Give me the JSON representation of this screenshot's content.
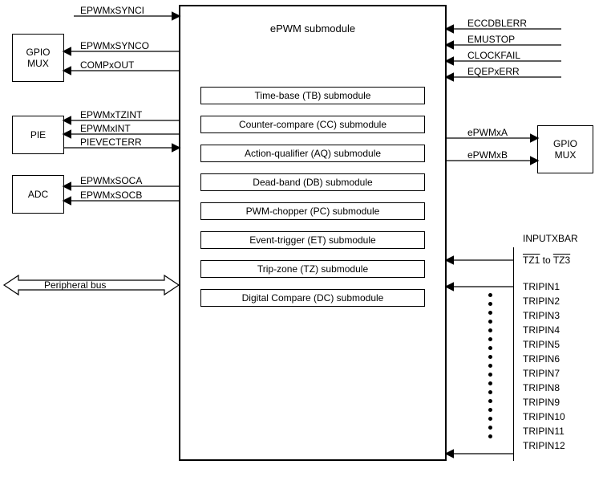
{
  "main_block": {
    "title": "ePWM submodule"
  },
  "left_boxes": {
    "gpio_mux": "GPIO\nMUX",
    "pie": "PIE",
    "adc": "ADC"
  },
  "right_boxes": {
    "gpio_mux": "GPIO\nMUX",
    "inputxbar_title": "INPUTXBAR"
  },
  "submodules": [
    "Time-base (TB) submodule",
    "Counter-compare (CC) submodule",
    "Action-qualifier (AQ) submodule",
    "Dead-band (DB) submodule",
    "PWM-chopper (PC) submodule",
    "Event-trigger (ET) submodule",
    "Trip-zone (TZ) submodule",
    "Digital Compare (DC) submodule"
  ],
  "left_signals": {
    "sync_in": "EPWMxSYNCI",
    "sync_out": "EPWMxSYNCO",
    "comp_out": "COMPxOUT",
    "tzint": "EPWMxTZINT",
    "xint": "EPWMxINT",
    "pievect": "PIEVECTERR",
    "soca": "EPWMxSOCA",
    "socb": "EPWMxSOCB",
    "pbus": "Peripheral bus"
  },
  "right_signals": {
    "eccdblerr": "ECCDBLERR",
    "emustop": "EMUSTOP",
    "clockfail": "CLOCKFAIL",
    "eqepxerr": "EQEPxERR",
    "epwma": "ePWMxA",
    "epwmb": "ePWMxB"
  },
  "inputxbar": {
    "tz": "TZ1 to TZ3",
    "tripins": [
      "TRIPIN1",
      "TRIPIN2",
      "TRIPIN3",
      "TRIPIN4",
      "TRIPIN5",
      "TRIPIN6",
      "TRIPIN7",
      "TRIPIN8",
      "TRIPIN9",
      "TRIPIN10",
      "TRIPIN11",
      "TRIPIN12"
    ]
  },
  "chart_data": {
    "type": "diagram",
    "title": "ePWM submodule block diagram",
    "nodes": [
      {
        "id": "epwm",
        "label": "ePWM submodule",
        "contains": [
          "Time-base (TB) submodule",
          "Counter-compare (CC) submodule",
          "Action-qualifier (AQ) submodule",
          "Dead-band (DB) submodule",
          "PWM-chopper (PC) submodule",
          "Event-trigger (ET) submodule",
          "Trip-zone (TZ) submodule",
          "Digital Compare (DC) submodule"
        ]
      },
      {
        "id": "gpio_mux_left",
        "label": "GPIO MUX"
      },
      {
        "id": "pie",
        "label": "PIE"
      },
      {
        "id": "adc",
        "label": "ADC"
      },
      {
        "id": "gpio_mux_right",
        "label": "GPIO MUX"
      },
      {
        "id": "inputxbar",
        "label": "INPUTXBAR",
        "contains": [
          "TZ1 to TZ3",
          "TRIPIN1",
          "TRIPIN2",
          "TRIPIN3",
          "TRIPIN4",
          "TRIPIN5",
          "TRIPIN6",
          "TRIPIN7",
          "TRIPIN8",
          "TRIPIN9",
          "TRIPIN10",
          "TRIPIN11",
          "TRIPIN12"
        ]
      },
      {
        "id": "pbus",
        "label": "Peripheral bus"
      }
    ],
    "edges": [
      {
        "from": "ext",
        "to": "epwm",
        "label": "EPWMxSYNCI",
        "dir": "in"
      },
      {
        "from": "epwm",
        "to": "gpio_mux_left",
        "label": "EPWMxSYNCO",
        "dir": "out"
      },
      {
        "from": "epwm",
        "to": "gpio_mux_left",
        "label": "COMPxOUT",
        "dir": "out"
      },
      {
        "from": "epwm",
        "to": "pie",
        "label": "EPWMxTZINT",
        "dir": "out"
      },
      {
        "from": "epwm",
        "to": "pie",
        "label": "EPWMxINT",
        "dir": "out"
      },
      {
        "from": "pie",
        "to": "epwm",
        "label": "PIEVECTERR",
        "dir": "in"
      },
      {
        "from": "epwm",
        "to": "adc",
        "label": "EPWMxSOCA",
        "dir": "out"
      },
      {
        "from": "epwm",
        "to": "adc",
        "label": "EPWMxSOCB",
        "dir": "out"
      },
      {
        "from": "pbus",
        "to": "epwm",
        "label": "Peripheral bus",
        "dir": "bidir"
      },
      {
        "from": "ext",
        "to": "epwm",
        "label": "ECCDBLERR",
        "dir": "in"
      },
      {
        "from": "ext",
        "to": "epwm",
        "label": "EMUSTOP",
        "dir": "in"
      },
      {
        "from": "ext",
        "to": "epwm",
        "label": "CLOCKFAIL",
        "dir": "in"
      },
      {
        "from": "ext",
        "to": "epwm",
        "label": "EQEPxERR",
        "dir": "in"
      },
      {
        "from": "epwm",
        "to": "gpio_mux_right",
        "label": "ePWMxA",
        "dir": "out"
      },
      {
        "from": "epwm",
        "to": "gpio_mux_right",
        "label": "ePWMxB",
        "dir": "out"
      },
      {
        "from": "inputxbar",
        "to": "epwm",
        "label": "TZ1 to TZ3",
        "dir": "in"
      },
      {
        "from": "inputxbar",
        "to": "epwm",
        "label": "TRIPIN1..12",
        "dir": "in"
      }
    ]
  }
}
